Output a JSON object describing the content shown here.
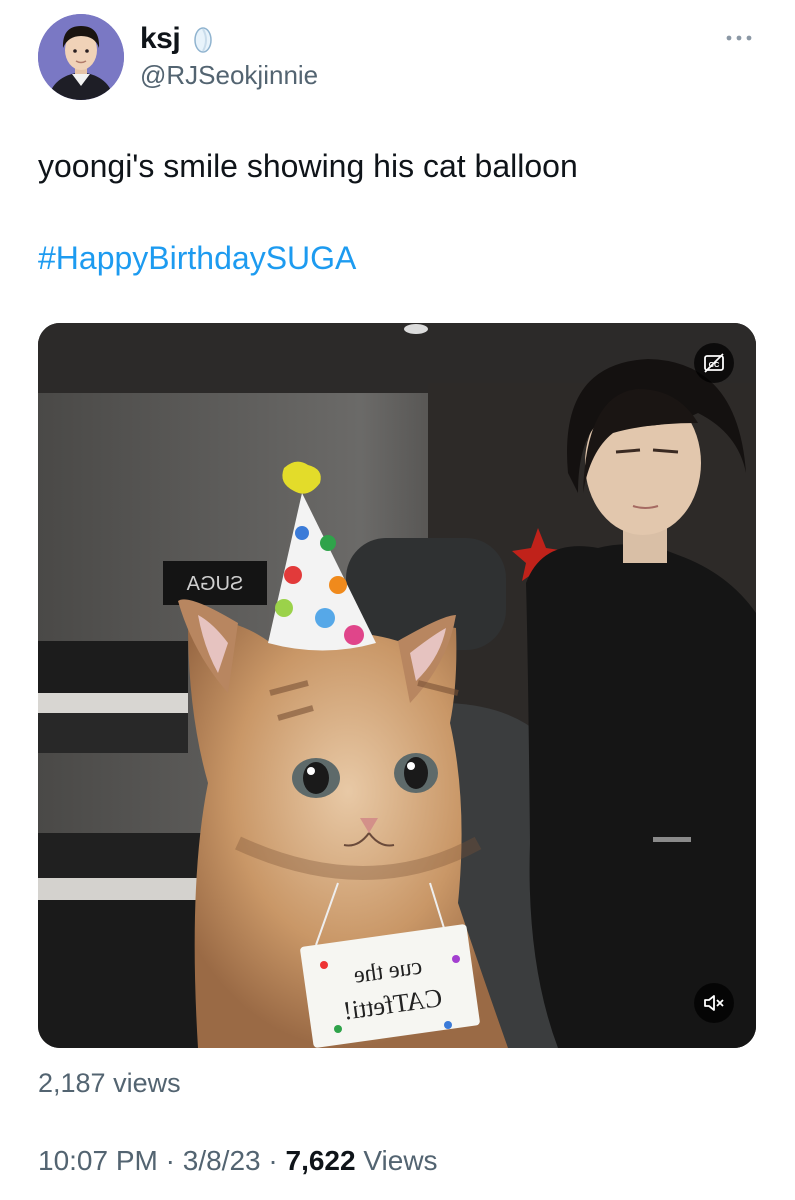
{
  "tweet": {
    "display_name": "ksj",
    "handle": "@RJSeokjinnie",
    "text": "yoongi's smile showing his cat balloon",
    "hashtag": "#HappyBirthdaySUGA",
    "media": {
      "sign_text": "SUGA",
      "card_line1": "cue the",
      "card_line2": "CATfetti!"
    },
    "video_views": "2,187 views",
    "time": "10:07 PM",
    "date": "3/8/23",
    "views_count": "7,622",
    "views_label": "Views",
    "separator": "·"
  },
  "icons": {
    "more": "more-icon",
    "captions": "closed-captions-icon",
    "mute": "volume-muted-icon",
    "name_emoji": "moon-emoji-icon"
  },
  "colors": {
    "hashtag": "#1d9bf0",
    "secondary_text": "#536471",
    "primary_text": "#0f1419"
  }
}
